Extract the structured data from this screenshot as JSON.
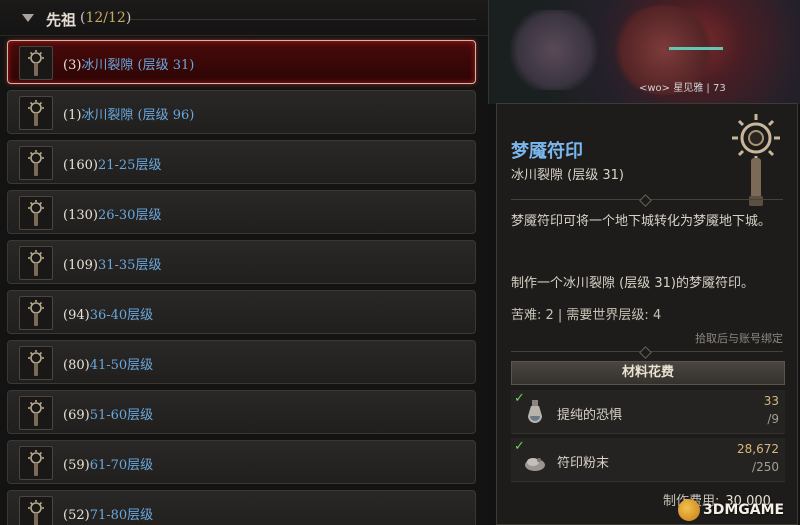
{
  "header": {
    "title": "先祖",
    "count_open": "(",
    "count_value": "12/12",
    "count_close": ")"
  },
  "rows": [
    {
      "num": "(3)",
      "text": "冰川裂隙 (层级 31)",
      "selected": true
    },
    {
      "num": "(1)",
      "text": "冰川裂隙 (层级 96)"
    },
    {
      "num": "(160)",
      "text": "21-25层级"
    },
    {
      "num": "(130)",
      "text": "26-30层级"
    },
    {
      "num": "(109)",
      "text": "31-35层级"
    },
    {
      "num": "(94)",
      "text": "36-40层级"
    },
    {
      "num": "(80)",
      "text": "41-50层级"
    },
    {
      "num": "(69)",
      "text": "51-60层级"
    },
    {
      "num": "(59)",
      "text": "61-70层级"
    },
    {
      "num": "(52)",
      "text": "71-80层级"
    }
  ],
  "scene": {
    "nameplate": "<wo> 星见雅 | 73"
  },
  "tooltip": {
    "title": "梦魇符印",
    "subtitle": "冰川裂隙 (层级 31)",
    "description": "梦魇符印可将一个地下城转化为梦魇地下城。",
    "craft_text": "制作一个冰川裂隙 (层级 31)的梦魇符印。",
    "difficulty": "苦难: 2 | 需要世界层级: 4",
    "binding": "拾取后与账号绑定",
    "materials_header": "材料花费",
    "materials": [
      {
        "icon": "vial-icon",
        "name": "提纯的恐惧",
        "have": "33",
        "need": "/9",
        "check": "✓"
      },
      {
        "icon": "dust-icon",
        "name": "符印粉末",
        "have": "28,672",
        "need": "/250",
        "check": "✓"
      }
    ],
    "cost_label": "制作费用:",
    "cost_value": "30,000"
  },
  "watermark": "3DMGAME",
  "colors": {
    "accent_blue": "#6aa7dc",
    "selected_red": "#4a0a0a",
    "check_green": "#6bd25a"
  }
}
